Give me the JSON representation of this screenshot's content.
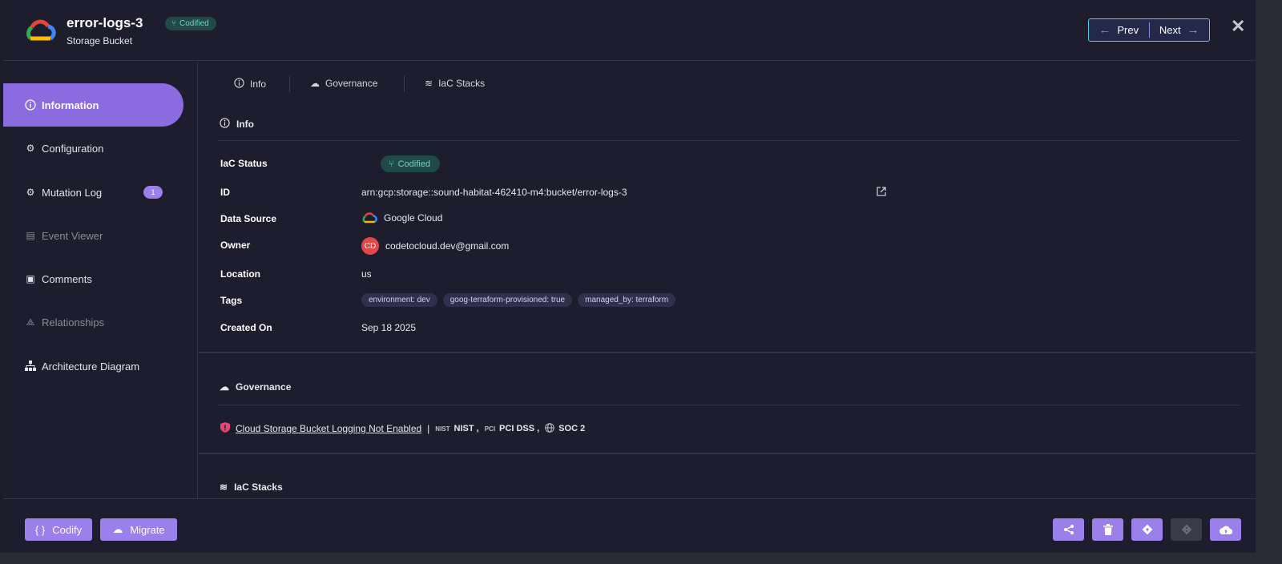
{
  "header": {
    "title": "error-logs-3",
    "subtitle": "Storage Bucket",
    "badge": "Codified",
    "prev_label": "Prev",
    "next_label": "Next",
    "close_glyph": "✕"
  },
  "sidebar": {
    "items": [
      {
        "label": "Information",
        "icon": "info-icon"
      },
      {
        "label": "Configuration",
        "icon": "gears-icon"
      },
      {
        "label": "Mutation Log",
        "icon": "mutation-icon",
        "count": "1"
      },
      {
        "label": "Event Viewer",
        "icon": "event-viewer-icon"
      },
      {
        "label": "Comments",
        "icon": "comments-icon"
      },
      {
        "label": "Relationships",
        "icon": "relationships-icon"
      },
      {
        "label": "Architecture Diagram",
        "icon": "architecture-icon"
      }
    ]
  },
  "tabs": [
    {
      "label": "Info",
      "icon": "info-icon"
    },
    {
      "label": "Governance",
      "icon": "governance-icon"
    },
    {
      "label": "IaC Stacks",
      "icon": "layers-icon"
    }
  ],
  "info": {
    "heading": "Info",
    "fields": {
      "iac_status_label": "IaC Status",
      "iac_status_value": "Codified",
      "id_label": "ID",
      "id_value": "arn:gcp:storage::sound-habitat-462410-m4:bucket/error-logs-3",
      "data_source_label": "Data Source",
      "data_source_value": "Google Cloud",
      "owner_label": "Owner",
      "owner_initials": "CD",
      "owner_value": "codetocloud.dev@gmail.com",
      "location_label": "Location",
      "location_value": "us",
      "tags_label": "Tags",
      "created_label": "Created On",
      "created_value": "Sep 18 2025"
    },
    "tags": [
      "environment: dev",
      "goog-terraform-provisioned: true",
      "managed_by: terraform"
    ]
  },
  "governance": {
    "heading": "Governance",
    "policy": "Cloud Storage Bucket Logging Not Enabled",
    "separator": "|",
    "frameworks": [
      {
        "icon_text": "NIST",
        "label": "NIST ,"
      },
      {
        "icon_text": "PCI",
        "label": "PCI DSS ,"
      },
      {
        "icon_text": "",
        "label": "SOC 2"
      }
    ]
  },
  "iac": {
    "heading": "IaC Stacks"
  },
  "footer": {
    "codify_label": "Codify",
    "codify_glyph": "{ }",
    "migrate_label": "Migrate",
    "actions": [
      "share-icon",
      "trash-icon",
      "diamond-icon",
      "git-icon",
      "cloud-upload-icon"
    ]
  },
  "colors": {
    "accent": "#9b7fea",
    "active_nav": "#8b6bdf",
    "codified_bg": "#1f4a47",
    "codified_text": "#6fd6c4",
    "panel_bg": "#1e1d2d"
  }
}
